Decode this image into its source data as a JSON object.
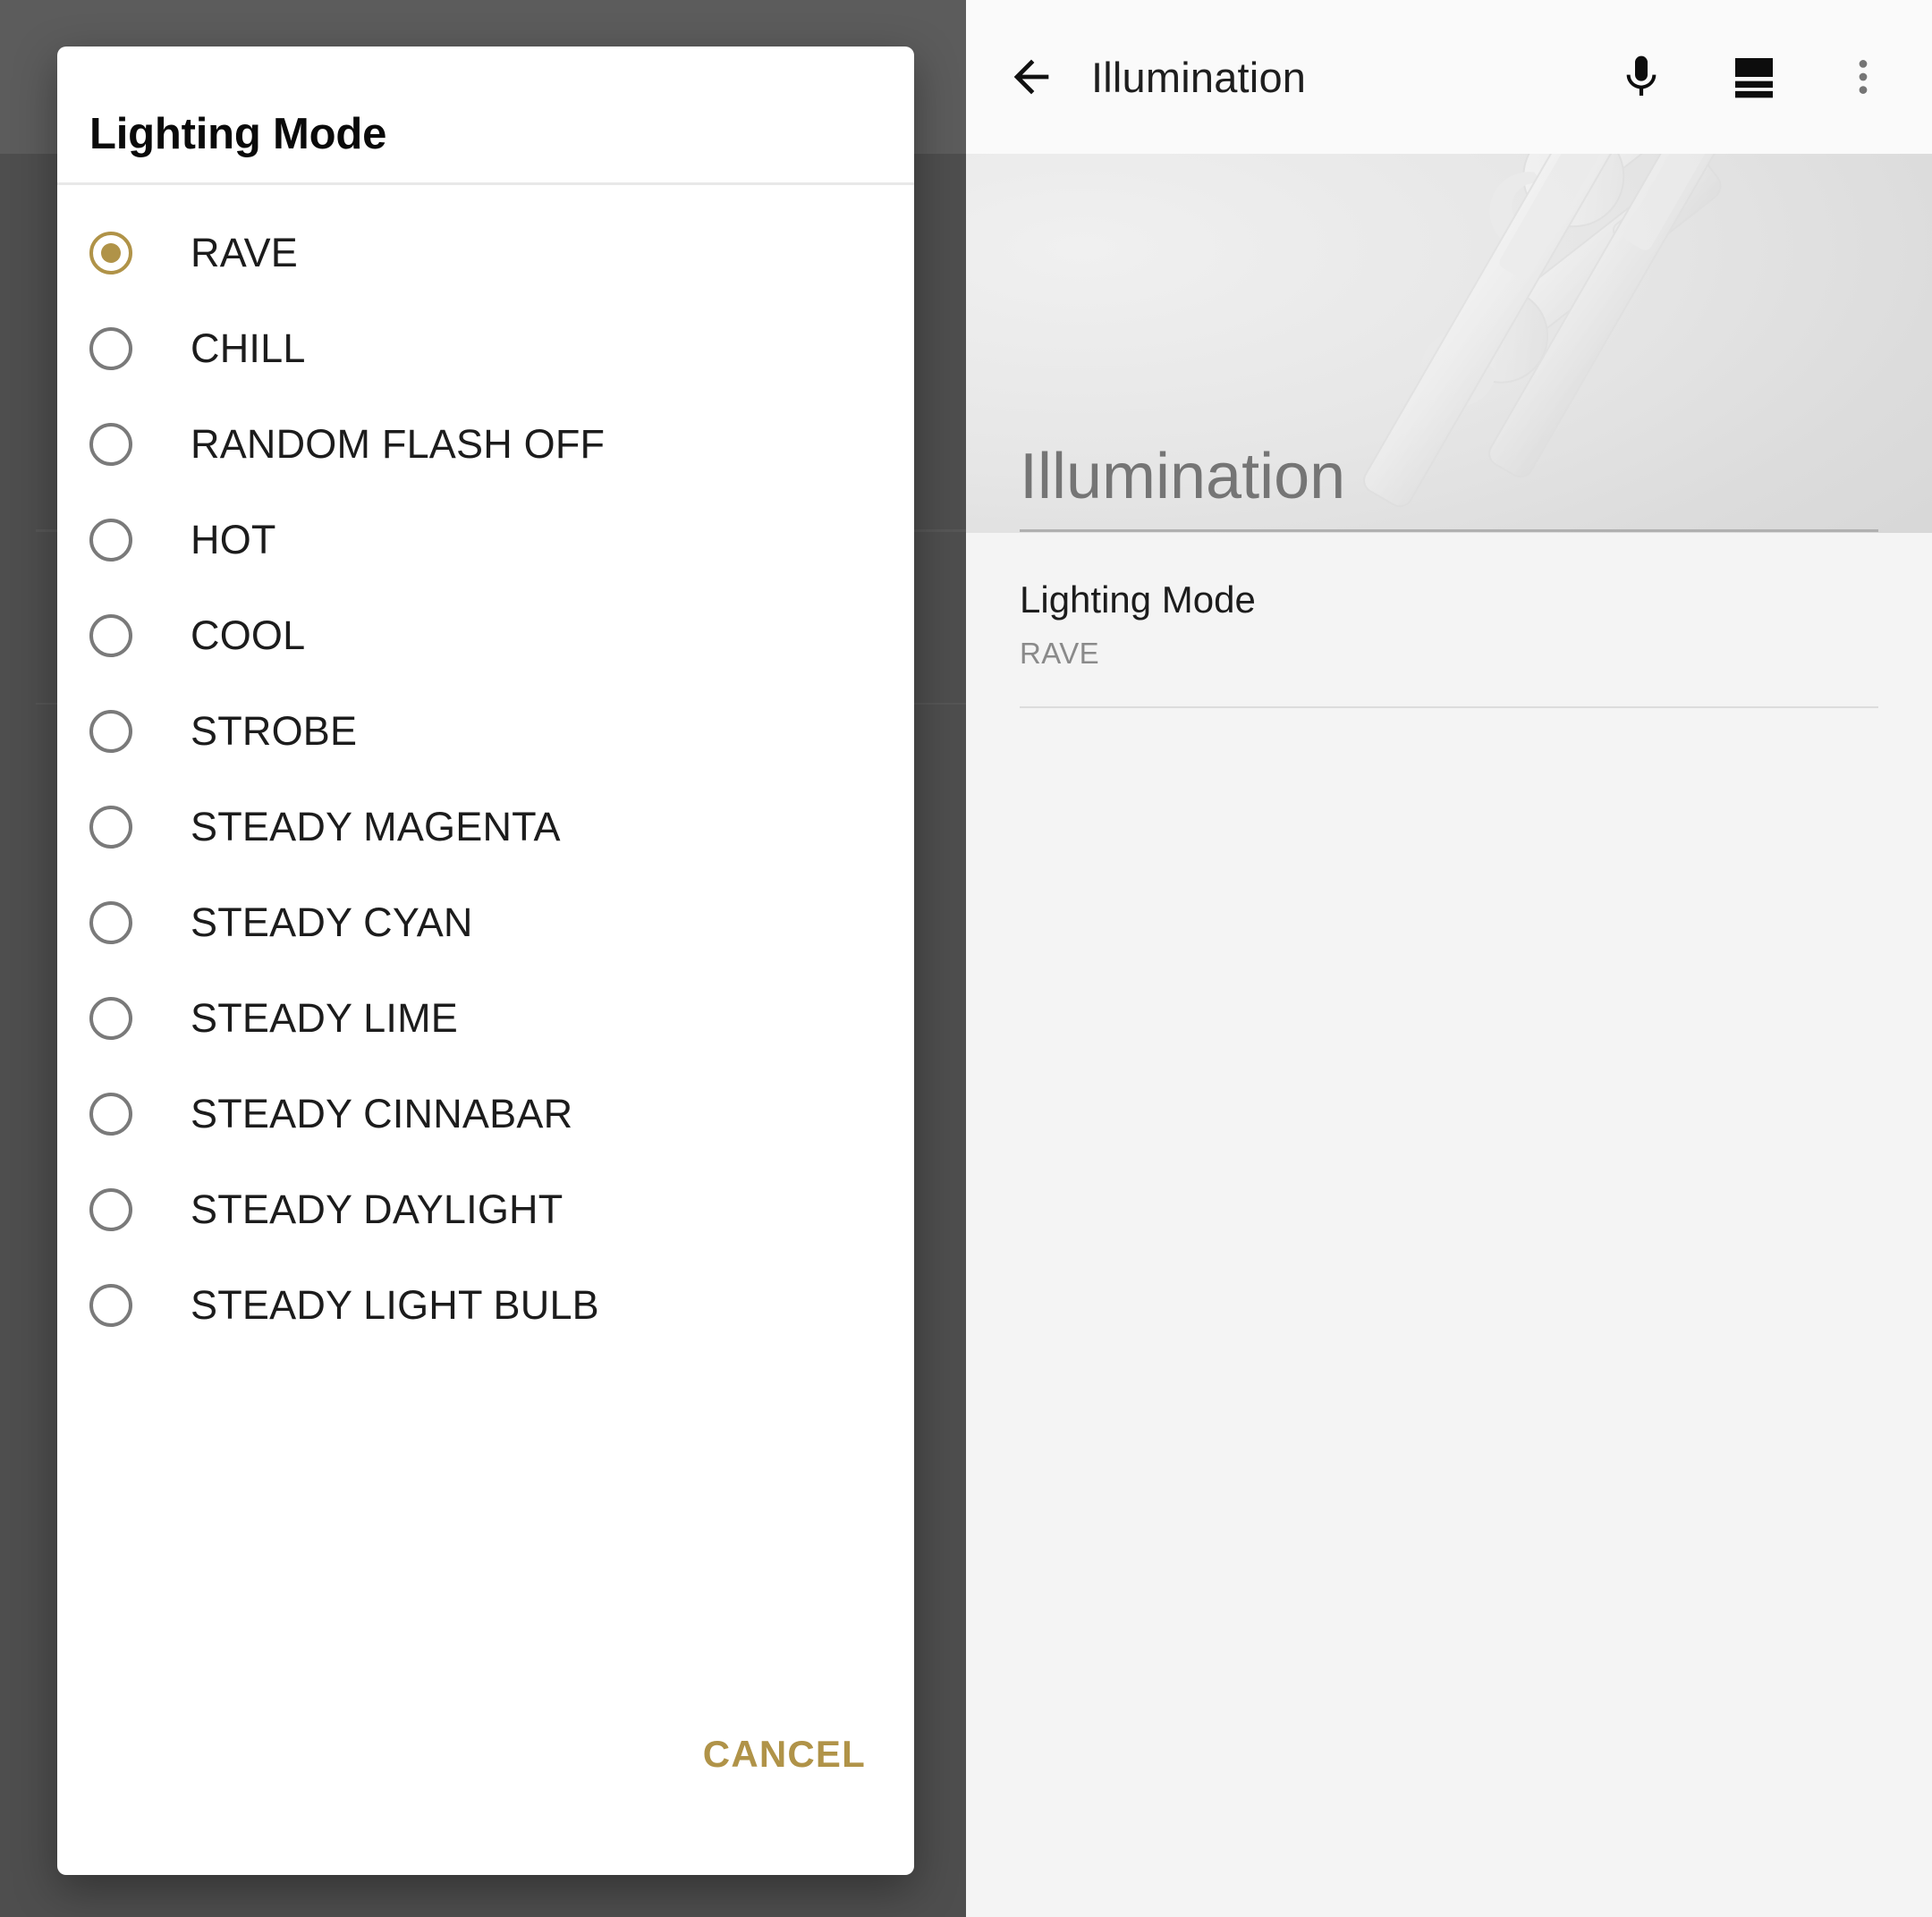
{
  "app_bar": {
    "back_label": "Back",
    "title": "Illumination",
    "actions": [
      {
        "name": "mic-icon",
        "label": "Voice input"
      },
      {
        "name": "view-agenda-icon",
        "label": "View layout"
      },
      {
        "name": "overflow-menu-icon",
        "label": "More options"
      }
    ]
  },
  "hero": {
    "title": "Illumination"
  },
  "preferences": [
    {
      "title": "Lighting Mode",
      "summary": "RAVE"
    }
  ],
  "dialog": {
    "title": "Lighting Mode",
    "selected": "RAVE",
    "options": [
      "RAVE",
      "CHILL",
      "RANDOM FLASH OFF",
      "HOT",
      "COOL",
      "STROBE",
      "STEADY MAGENTA",
      "STEADY CYAN",
      "STEADY LIME",
      "STEADY CINNABAR",
      "STEADY DAYLIGHT",
      "STEADY LIGHT BULB"
    ],
    "cancel_label": "CANCEL"
  },
  "colors": {
    "accent_gold": "#B09348",
    "radio_unchecked": "#7A7A7A",
    "scrim_top": "#5C5C5C",
    "scrim_bottom": "#4E4E4E",
    "appbar_bg": "#FAFAFA",
    "page_bg": "#F4F4F4"
  }
}
